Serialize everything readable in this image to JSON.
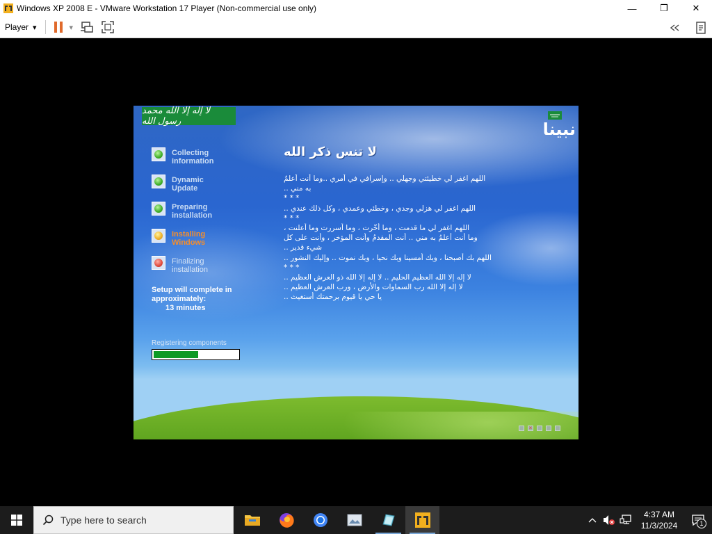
{
  "window": {
    "title": "Windows XP 2008 E - VMware Workstation 17 Player (Non-commercial use only)",
    "minimize_glyph": "—",
    "maximize_glyph": "❐",
    "close_glyph": "✕"
  },
  "toolbar": {
    "player_label": "Player",
    "dropdown_glyph": "▾"
  },
  "setup": {
    "flag_text": "لا إله إلا الله محمد رسول الله",
    "logo_text": "نبينا",
    "steps": [
      {
        "label": "Collecting\ninformation",
        "state": "done"
      },
      {
        "label": "Dynamic\nUpdate",
        "state": "done"
      },
      {
        "label": "Preparing\ninstallation",
        "state": "done"
      },
      {
        "label": "Installing\nWindows",
        "state": "active"
      },
      {
        "label": "Finalizing\ninstallation",
        "state": "pending"
      }
    ],
    "complete_line1": "Setup will complete in",
    "complete_line2": "approximately:",
    "minutes": "13 minutes",
    "progress_label": "Registering components",
    "progress_fraction": 0.53,
    "heading": "لا تنس ذكر الله",
    "lines": [
      "اللهم اغفر لي خطيئتي وجهلي .. وإسرافي في أمري ..وما أنت أعلمٌ",
      "به مني ..",
      "* * *",
      "اللهم اغفر لي هزلي وجدي ، وخطئي وعمدي ، وكل ذلك عندي ..",
      "* * *",
      "اللهم اغفر لي ما قدمت ، وما أخّرت ، وما أسررت وما أعلنت ،",
      "وما أنت أعلمُ به مني .. أنت المقدمُ وأنت المؤخر ، وأنت على كل",
      "شيء قدير ..",
      "اللهم بك أصبحنا ، وبك أمسينا وبك نحيا ، وبك نموت .. وإليك النشور ..",
      "* * *",
      "لا إله إلا الله العظيم الحليم .. لا إله إلا الله ذو العرش العظيم ..",
      "لا إله إلا الله رب السماوات والأرض ، ورب العرش العظيم ..",
      "يا حي يا قيوم برحمتك أستغيث .."
    ],
    "nav_marks": [
      "",
      "×",
      "",
      "",
      ""
    ]
  },
  "taskbar": {
    "search_placeholder": "Type here to search",
    "time": "4:37 AM",
    "date": "11/3/2024",
    "notification_count": "1"
  }
}
